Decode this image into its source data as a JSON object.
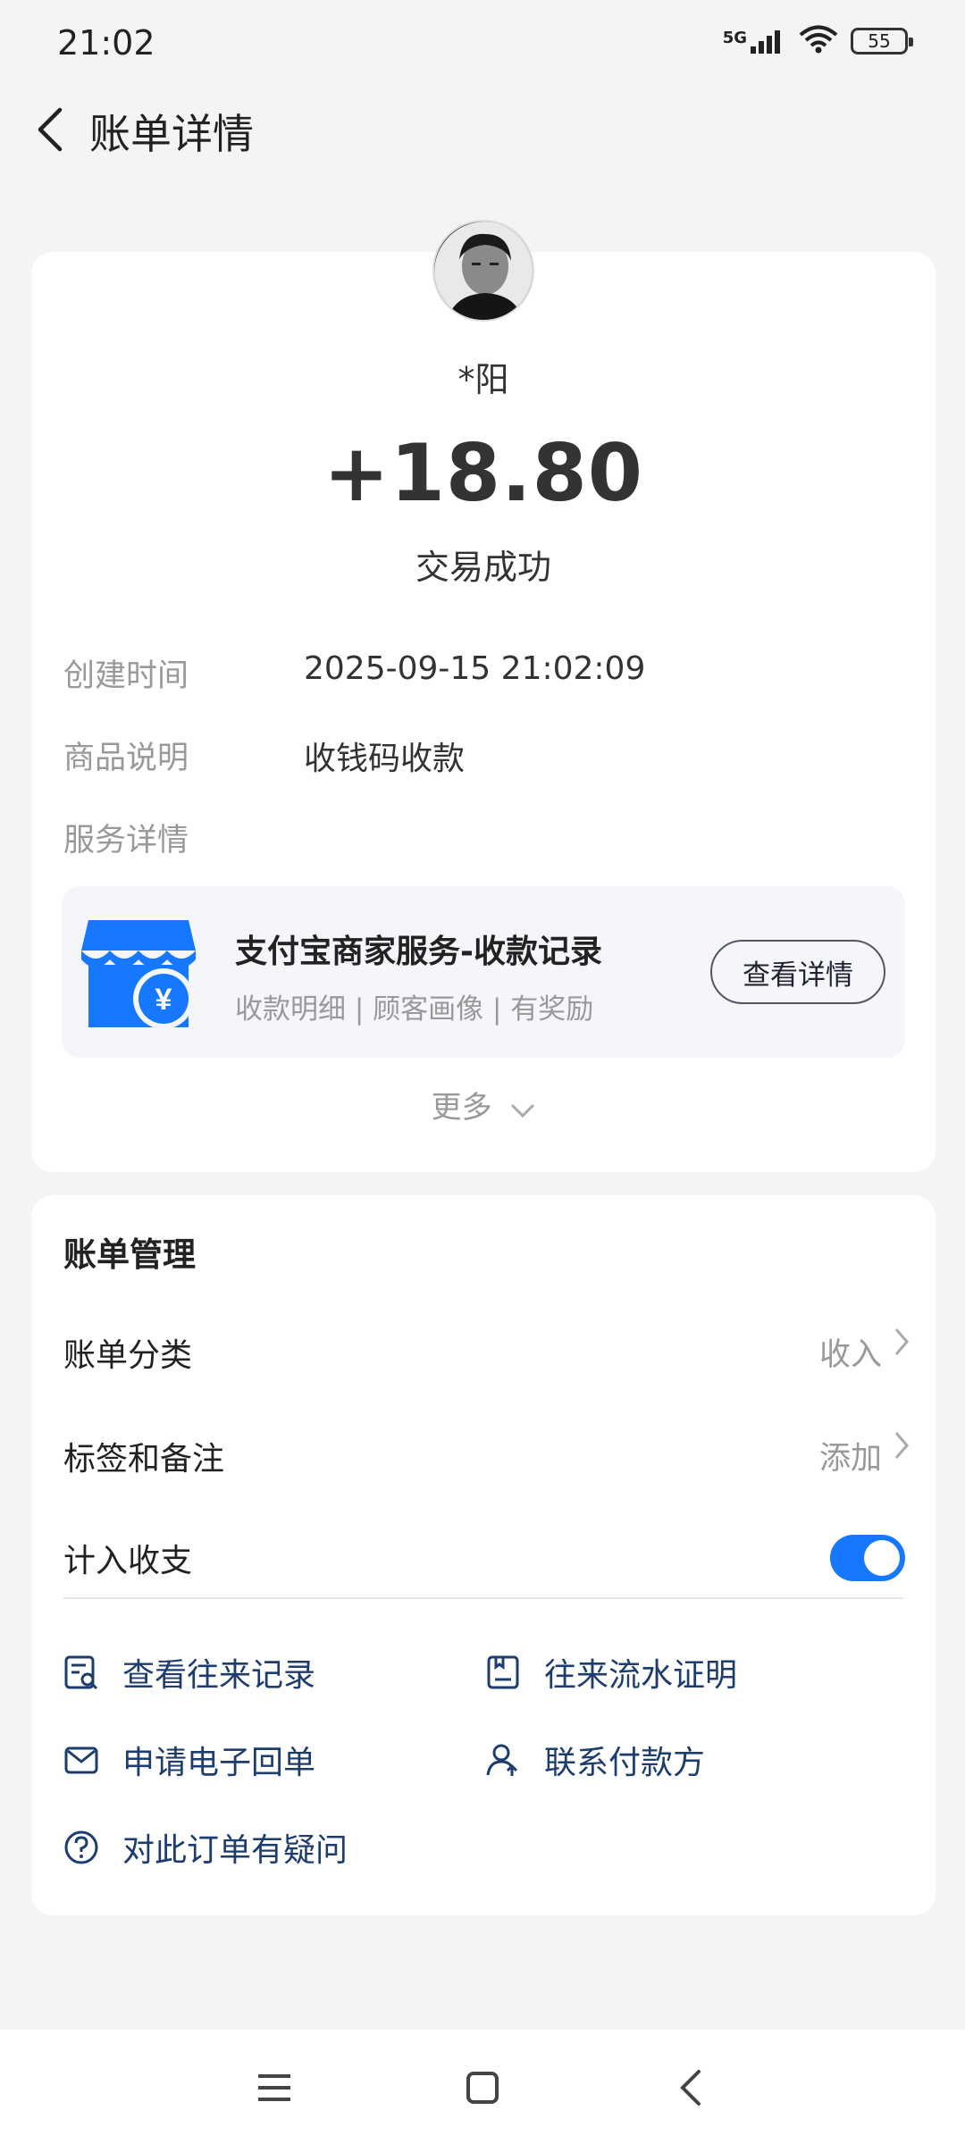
{
  "status_bar": {
    "time": "21:02",
    "network": "5G",
    "battery": "55",
    "icons": [
      "signal-icon",
      "wifi-icon",
      "battery-icon"
    ]
  },
  "header": {
    "title": "账单详情",
    "back_icon": "back-arrow-icon"
  },
  "bill": {
    "payer_name": "*阳",
    "amount": "+18.80",
    "status": "交易成功",
    "created_label": "创建时间",
    "created_value": "2025-09-15 21:02:09",
    "item_label": "商品说明",
    "item_value": "收钱码收款",
    "service_label": "服务详情"
  },
  "service": {
    "title": "支付宝商家服务-收款记录",
    "subtitle": "收款明细 | 顾客画像 | 有奖励",
    "button": "查看详情",
    "icon": "shop-yuan-icon",
    "accent_color": "#1677ff"
  },
  "more": {
    "label": "更多"
  },
  "manage": {
    "title": "账单管理",
    "category_label": "账单分类",
    "category_value": "收入",
    "tags_label": "标签和备注",
    "tags_value": "添加",
    "include_label": "计入收支",
    "include_on": true
  },
  "actions": {
    "records": "查看往来记录",
    "proof": "往来流水证明",
    "receipt": "申请电子回单",
    "contact": "联系付款方",
    "question": "对此订单有疑问"
  },
  "nav": [
    "menu-icon",
    "home-icon",
    "back-icon"
  ]
}
